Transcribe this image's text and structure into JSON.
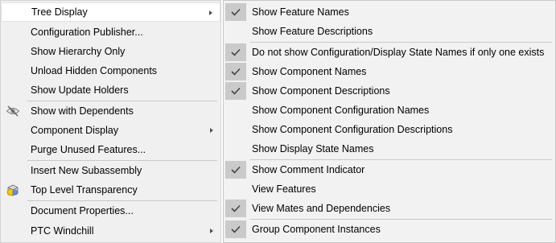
{
  "left_menu": {
    "tree_display": "Tree Display",
    "configuration_publisher": "Configuration Publisher...",
    "show_hierarchy_only": "Show Hierarchy Only",
    "unload_hidden_components": "Unload Hidden Components",
    "show_update_holders": "Show Update Holders",
    "show_with_dependents": "Show with Dependents",
    "component_display": "Component Display",
    "purge_unused_features": "Purge Unused Features...",
    "insert_new_subassembly": "Insert New Subassembly",
    "top_level_transparency": "Top Level Transparency",
    "document_properties": "Document Properties...",
    "ptc_windchill": "PTC Windchill"
  },
  "right_menu": {
    "show_feature_names": {
      "label": "Show Feature Names",
      "checked": true
    },
    "show_feature_descriptions": {
      "label": "Show Feature Descriptions",
      "checked": false
    },
    "do_not_show_config_names": {
      "label": "Do not show Configuration/Display State Names if only one exists",
      "checked": true
    },
    "show_component_names": {
      "label": "Show Component Names",
      "checked": true
    },
    "show_component_descriptions": {
      "label": "Show Component Descriptions",
      "checked": true
    },
    "show_component_configuration_names": {
      "label": "Show Component Configuration Names",
      "checked": false
    },
    "show_component_configuration_descriptions": {
      "label": "Show Component Configuration Descriptions",
      "checked": false
    },
    "show_display_state_names": {
      "label": "Show Display State Names",
      "checked": false
    },
    "show_comment_indicator": {
      "label": "Show Comment Indicator",
      "checked": true
    },
    "view_features": {
      "label": "View Features",
      "checked": false
    },
    "view_mates_and_dependencies": {
      "label": "View Mates and Dependencies",
      "checked": true
    },
    "group_component_instances": {
      "label": "Group Component Instances",
      "checked": true
    }
  },
  "colors": {
    "menu_bg": "#f0f0f0",
    "check_bg": "#cacaca",
    "highlight_bg": "#ffffff"
  }
}
